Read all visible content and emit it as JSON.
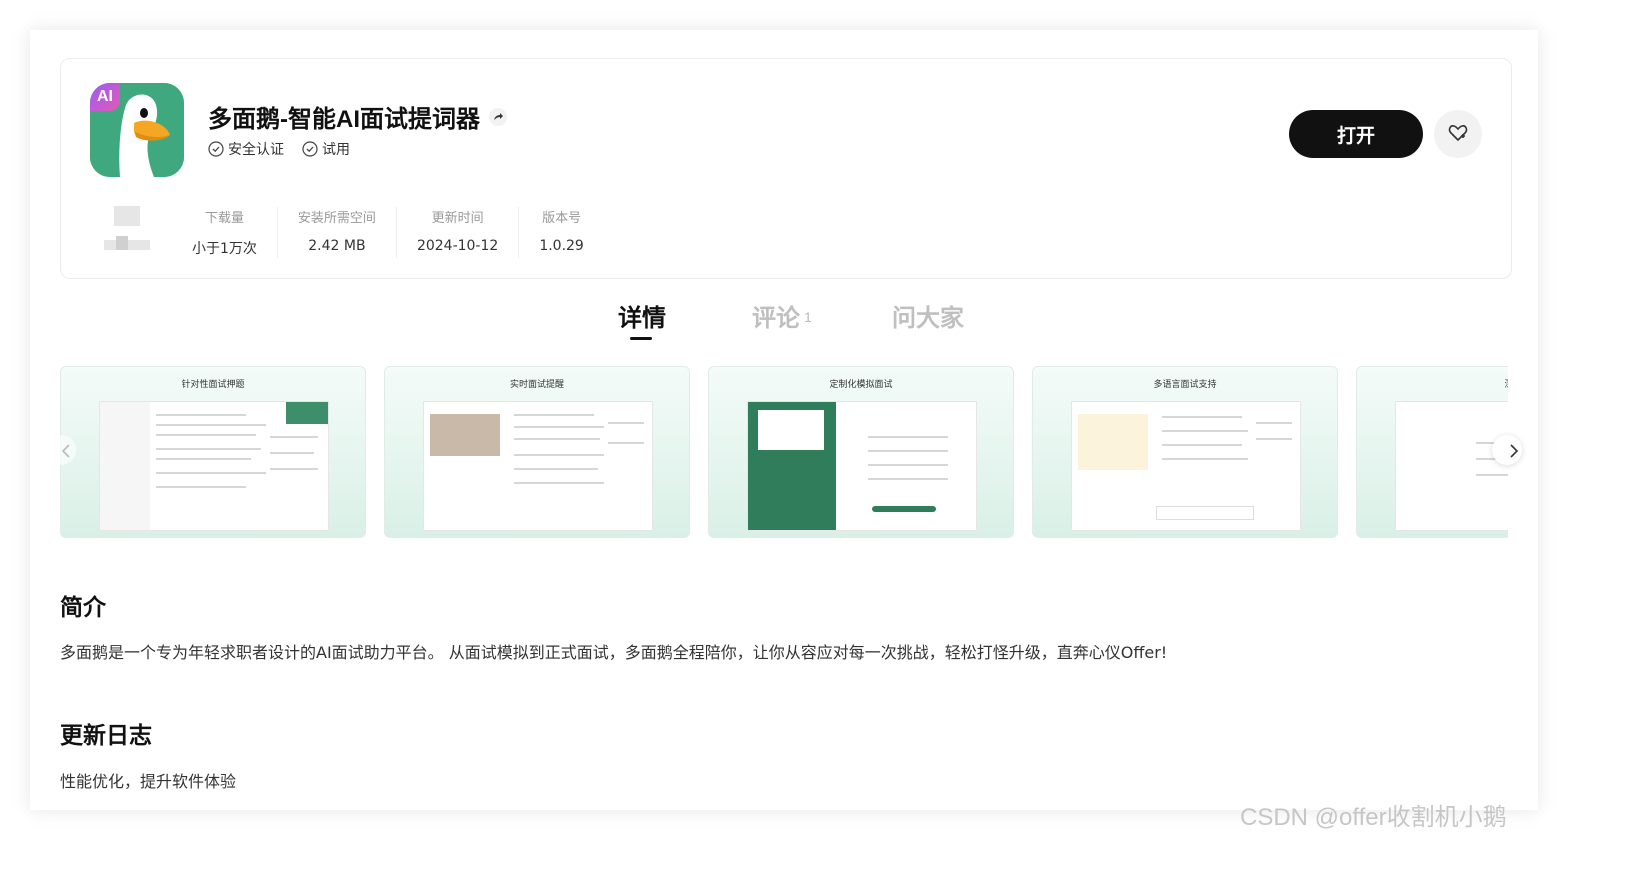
{
  "app": {
    "title": "多面鹅-智能AI面试提词器",
    "icon_badge": "AI",
    "tags": [
      "安全认证",
      "试用"
    ],
    "open_label": "打开"
  },
  "stats": [
    {
      "label": "下载量",
      "value": "小于1万次"
    },
    {
      "label": "安装所需空间",
      "value": "2.42 MB"
    },
    {
      "label": "更新时间",
      "value": "2024-10-12"
    },
    {
      "label": "版本号",
      "value": "1.0.29"
    }
  ],
  "tabs": [
    {
      "label": "详情",
      "active": true
    },
    {
      "label": "评论",
      "count": "1"
    },
    {
      "label": "问大家"
    }
  ],
  "screenshots": [
    {
      "title": "针对性面试押题"
    },
    {
      "title": "实时面试提醒"
    },
    {
      "title": "定制化模拟面试"
    },
    {
      "title": "多语言面试支持"
    },
    {
      "title": "深"
    }
  ],
  "intro": {
    "title": "简介",
    "text": "多面鹅是一个专为年轻求职者设计的AI面试助力平台。 从面试模拟到正式面试，多面鹅全程陪你，让你从容应对每一次挑战，轻松打怪升级，直奔心仪Offer!"
  },
  "changelog": {
    "title": "更新日志",
    "text": "性能优化，提升软件体验"
  },
  "watermark": "CSDN @offer收割机小鹅",
  "colors": {
    "icon_bg": "#3fa87e",
    "primary_button": "#111111",
    "screenshot_bg": "#d9f0e7"
  }
}
